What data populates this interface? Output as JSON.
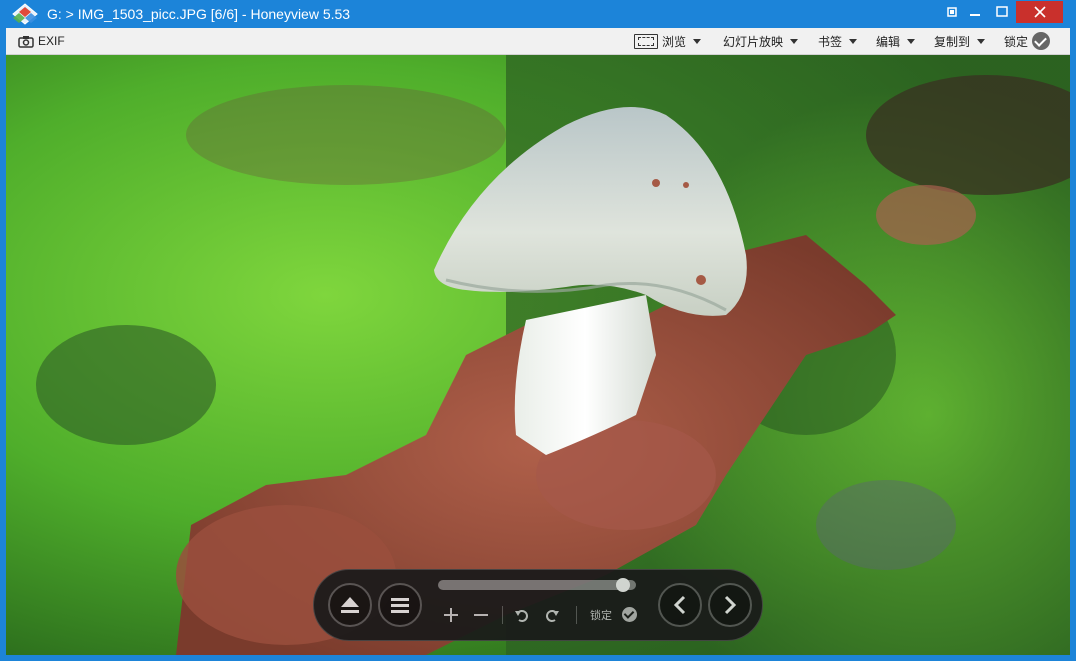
{
  "window": {
    "title": "G: > IMG_1503_picc.JPG [6/6] - Honeyview 5.53",
    "controls": {
      "pin": "pin-icon",
      "minimize": "minimize-icon",
      "maximize": "maximize-icon",
      "close": "close-icon"
    }
  },
  "toolbar": {
    "exif_label": "EXIF",
    "browse_label": "浏览",
    "slideshow_label": "幻灯片放映",
    "bookmark_label": "书签",
    "edit_label": "编辑",
    "copy_to_label": "复制到",
    "lock_label": "锁定"
  },
  "viewer": {
    "image_description_visible": false,
    "seek_progress": 0.97,
    "lock_label": "锁定"
  },
  "colors": {
    "titlebar": "#1c84d9",
    "close_button": "#c9302c",
    "toolbar_bg": "#f1f1f1"
  }
}
